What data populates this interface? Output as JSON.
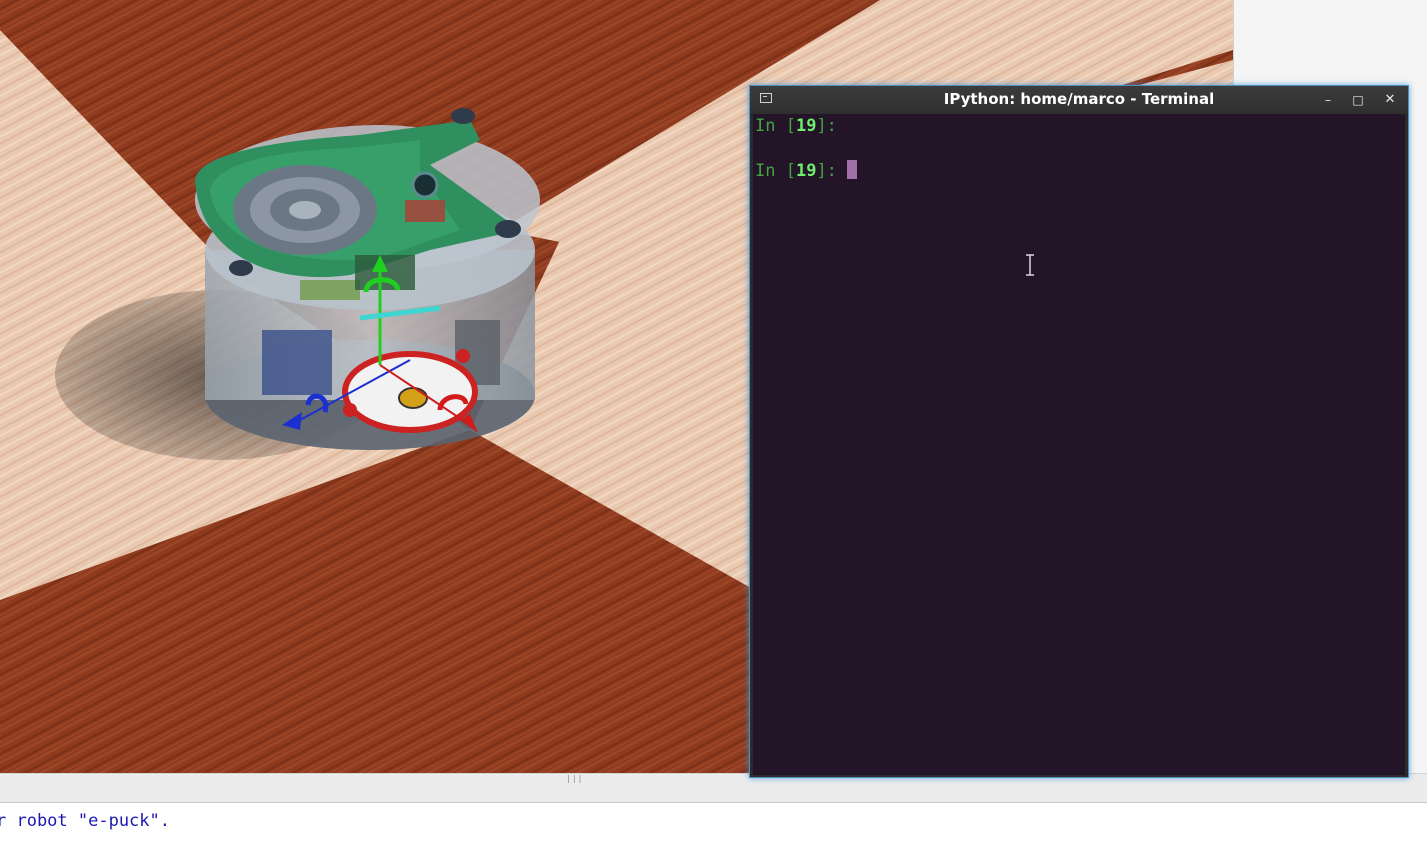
{
  "terminal": {
    "title": "IPython: home/marco - Terminal",
    "buttons": {
      "minimize": "–",
      "maximize": "□",
      "close": "✕"
    },
    "lines": [
      {
        "prefix": "In [",
        "number": "19",
        "suffix": "]: "
      },
      {
        "prefix": "In [",
        "number": "19",
        "suffix": "]: "
      }
    ]
  },
  "console": {
    "text": "r robot \"e-puck\"."
  },
  "splitter": {
    "grip": "|||"
  },
  "icons": {
    "terminal_icon": "terminal-icon",
    "minimize": "minimize-icon",
    "maximize": "maximize-icon",
    "close": "close-icon",
    "text_cursor": "ibeam-cursor-icon"
  },
  "colors": {
    "terminal_bg": "#241427",
    "prompt_green": "#3fa63f",
    "prompt_number": "#6ef06e",
    "console_text": "#1a1ab0",
    "window_glow": "#4a90c0"
  }
}
